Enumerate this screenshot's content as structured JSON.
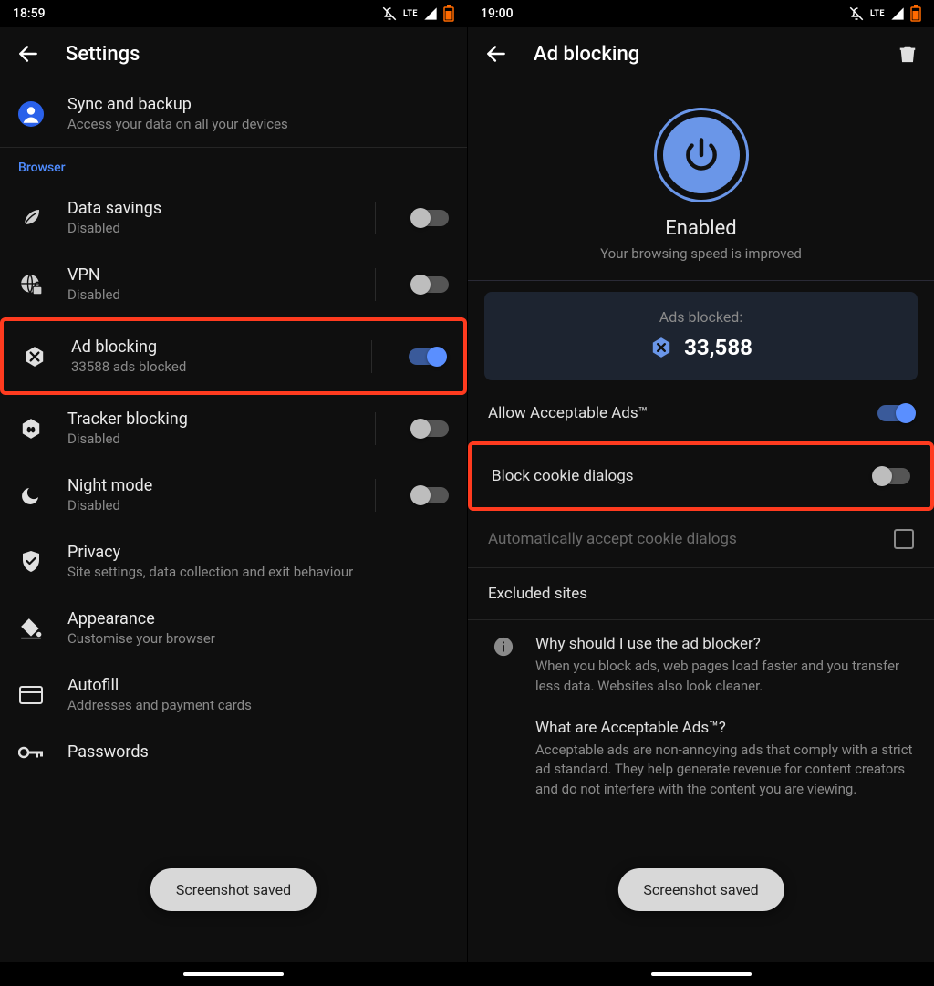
{
  "left": {
    "time": "18:59",
    "title": "Settings",
    "sync": {
      "label": "Sync and backup",
      "sub": "Access your data on all your devices"
    },
    "section_browser": "Browser",
    "items": {
      "data_savings": {
        "label": "Data savings",
        "sub": "Disabled"
      },
      "vpn": {
        "label": "VPN",
        "sub": "Disabled"
      },
      "ad_blocking": {
        "label": "Ad blocking",
        "sub": "33588 ads blocked"
      },
      "tracker_blocking": {
        "label": "Tracker blocking",
        "sub": "Disabled"
      },
      "night_mode": {
        "label": "Night mode",
        "sub": "Disabled"
      },
      "privacy": {
        "label": "Privacy",
        "sub": "Site settings, data collection and exit behaviour"
      },
      "appearance": {
        "label": "Appearance",
        "sub": "Customise your browser"
      },
      "autofill": {
        "label": "Autofill",
        "sub": "Addresses and payment cards"
      },
      "passwords": {
        "label": "Passwords"
      }
    },
    "toast": "Screenshot saved"
  },
  "right": {
    "time": "19:00",
    "title": "Ad blocking",
    "hero": {
      "status": "Enabled",
      "sub": "Your browsing speed is improved"
    },
    "stats": {
      "label": "Ads blocked:",
      "value": "33,588"
    },
    "allow_acceptable": "Allow Acceptable Ads™",
    "block_cookie": "Block cookie dialogs",
    "auto_accept": "Automatically accept cookie dialogs",
    "excluded": "Excluded sites",
    "faq1": {
      "q": "Why should I use the ad blocker?",
      "a": "When you block ads, web pages load faster and you transfer less data. Websites also look cleaner."
    },
    "faq2": {
      "q": "What are Acceptable Ads™?",
      "a": "Acceptable ads are non-annoying ads that comply with a strict ad standard. They help generate revenue for content creators and do not interfere with the content you are viewing."
    },
    "toast": "Screenshot saved"
  },
  "lte_label": "LTE"
}
